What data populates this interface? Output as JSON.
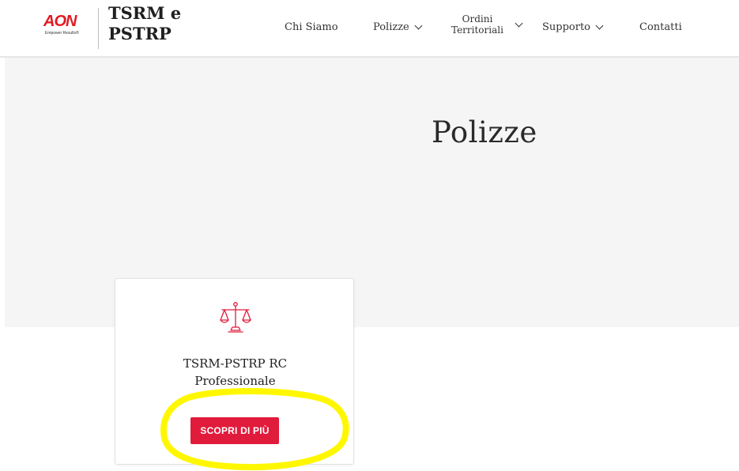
{
  "logo": {
    "brand": "AON",
    "tagline": "Empower Results®"
  },
  "site": {
    "title_line1": "TSRM e",
    "title_line2": "PSTRP"
  },
  "nav": {
    "chi_siamo": "Chi Siamo",
    "polizze": "Polizze",
    "ordini_line1": "Ordini",
    "ordini_line2": "Territoriali",
    "supporto": "Supporto",
    "contatti": "Contatti"
  },
  "hero": {
    "title": "Polizze"
  },
  "card": {
    "icon": "scale-icon",
    "title_line1": "TSRM-PSTRP RC",
    "title_line2": "Professionale",
    "button_label": "SCOPRI DI PIÙ"
  },
  "colors": {
    "accent": "#e11b3c",
    "brand_red": "#e11b22",
    "hero_bg": "#f5f5f6",
    "highlight": "#fff700"
  }
}
